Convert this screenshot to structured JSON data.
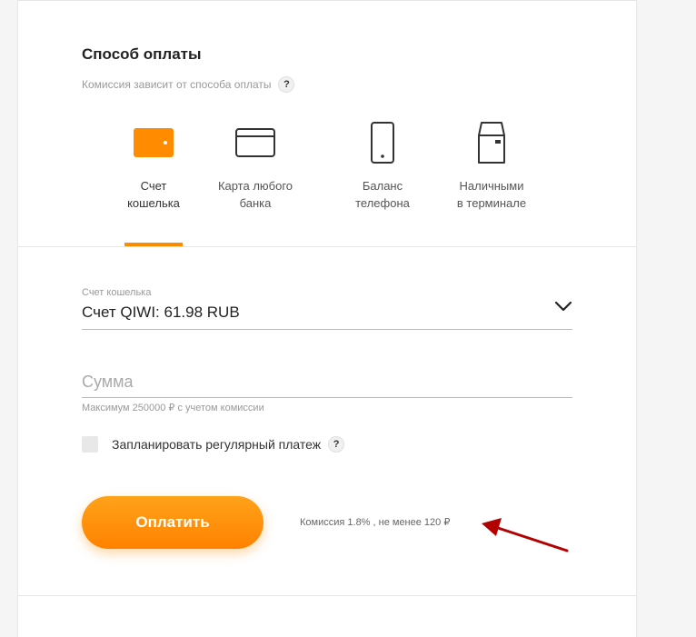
{
  "payment": {
    "title": "Способ оплаты",
    "subtitle": "Комиссия зависит от способа оплаты",
    "help_symbol": "?",
    "methods": [
      {
        "label": "Счет\nкошелька",
        "icon": "wallet-icon",
        "active": true
      },
      {
        "label": "Карта любого\nбанка",
        "icon": "bank-card-icon",
        "active": false
      },
      {
        "label": "Баланс\nтелефона",
        "icon": "phone-icon",
        "active": false
      },
      {
        "label": "Наличными\nв терминале",
        "icon": "terminal-icon",
        "active": false
      }
    ]
  },
  "form": {
    "wallet_label": "Счет кошелька",
    "wallet_value": "Счет QIWI: 61.98 RUB",
    "amount_placeholder": "Сумма",
    "amount_hint": "Максимум 250000 ₽ с учетом комиссии",
    "schedule_label": "Запланировать регулярный платеж",
    "schedule_checked": false
  },
  "actions": {
    "pay_label": "Оплатить",
    "commission_text": "Комиссия 1.8% , не менее 120 ₽"
  },
  "colors": {
    "accent": "#ff8c00",
    "annotation_arrow": "#b30000"
  }
}
